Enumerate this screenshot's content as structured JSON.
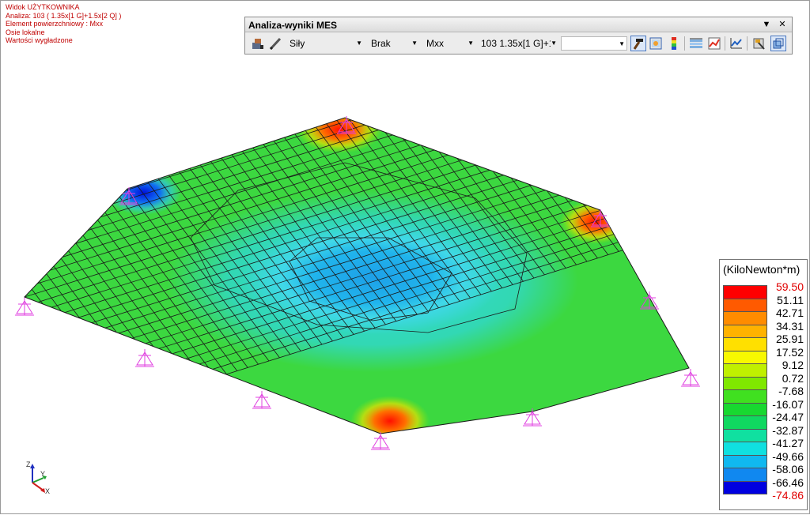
{
  "info": {
    "lines": [
      "Widok UŻYTKOWNIKA",
      "Analiza: 103 ( 1.35x[1 G]+1.5x[2 Q] )",
      "Element powierzchniowy : Mxx",
      "Osie lokalne",
      "Wartości wygładzone"
    ],
    "color": "#c00000"
  },
  "panel": {
    "title": "Analiza-wyniki MES",
    "combos": {
      "type": "Siły",
      "option": "Brak",
      "component": "Mxx",
      "case": "103 1.35x[1 G]+1",
      "extra": ""
    },
    "icons": [
      "model-icon",
      "pencil-icon",
      "hammer-icon",
      "map-icon",
      "scale-icon",
      "grid-icon",
      "chart-icon",
      "line-chart-icon",
      "hammer-settings-icon",
      "panel-3d-icon"
    ]
  },
  "legend": {
    "title": "(KiloNewton*m)",
    "values": [
      "59.50",
      "51.11",
      "42.71",
      "34.31",
      "25.91",
      "17.52",
      "9.12",
      "0.72",
      "-7.68",
      "-16.07",
      "-24.47",
      "-32.87",
      "-41.27",
      "-49.66",
      "-58.06",
      "-66.46",
      "-74.86"
    ],
    "colors": [
      "#ff0000",
      "#ff5a00",
      "#ff8c00",
      "#ffb200",
      "#ffe000",
      "#f8f800",
      "#c0f000",
      "#80e800",
      "#40e020",
      "#18d830",
      "#10d860",
      "#10e0a0",
      "#10e0e0",
      "#10b8f0",
      "#1088f0",
      "#0000e0"
    ]
  },
  "axes": {
    "z": "Z",
    "y": "Y",
    "x": "X"
  }
}
